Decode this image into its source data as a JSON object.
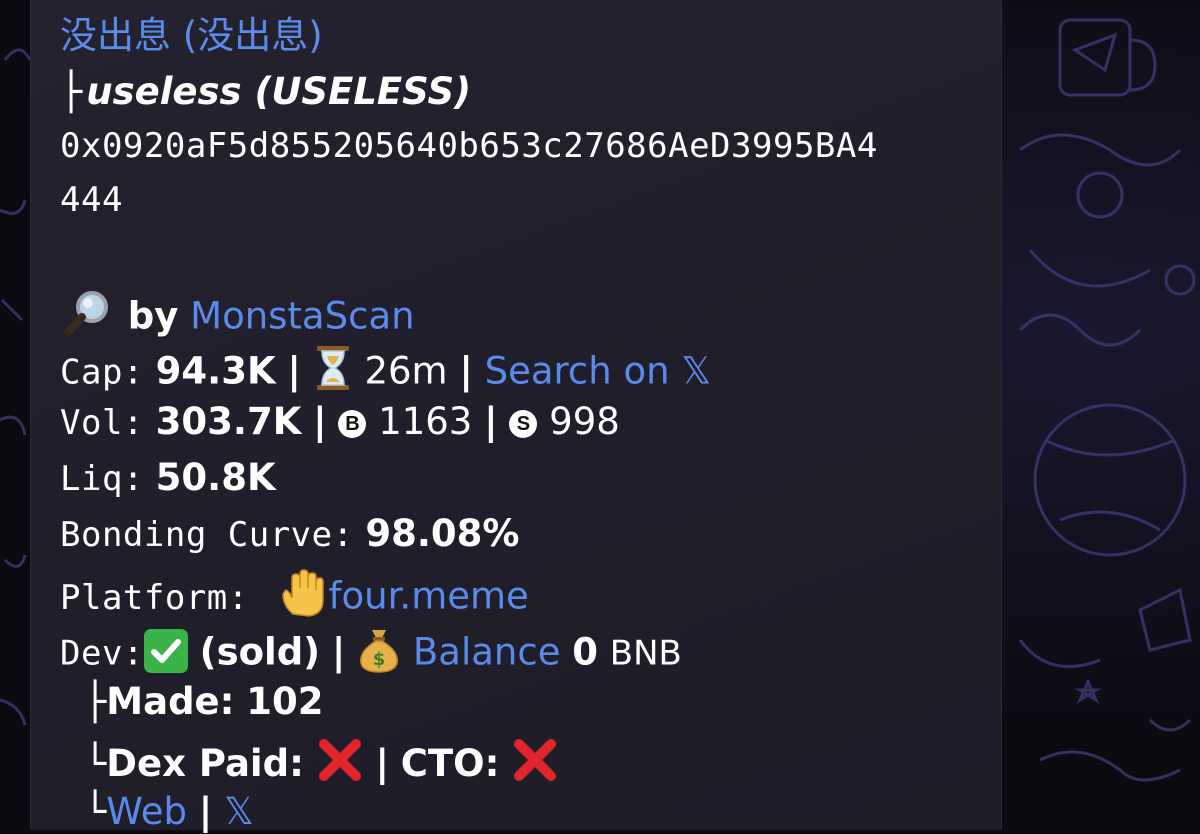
{
  "header": {
    "title_link": "没出息 (没出息)",
    "token_prefix": "├",
    "token_name": "useless (USELESS)",
    "contract_line1": "0x0920aF5d855205640b653c27686AeD3995BA4",
    "contract_line2": "444"
  },
  "scanner": {
    "by_label": "by",
    "by_link": "MonstaScan"
  },
  "stats": {
    "cap_label": "Cap:",
    "cap_value": "94.3K",
    "sep": "|",
    "age": "26m",
    "search_link": "Search on",
    "vol_label": "Vol:",
    "vol_value": "303.7K",
    "buy_icon_letter": "B",
    "buys": "1163",
    "sell_icon_letter": "S",
    "sells": "998",
    "liq_label": "Liq:",
    "liq_value": "50.8K",
    "bonding_label": "Bonding Curve:",
    "bonding_value": "98.08%",
    "platform_label": "Platform:",
    "platform_link": "four.meme"
  },
  "dev": {
    "label": "Dev:",
    "status": "(sold)",
    "balance_link": "Balance",
    "balance_value": "0",
    "balance_unit": "BNB",
    "made_prefix": "├",
    "made_label": "Made:",
    "made_value": "102",
    "dex_prefix": "└",
    "dex_label": "Dex Paid:",
    "cto_label": "CTO:",
    "web_prefix": "└",
    "web_link": "Web"
  },
  "icons": {
    "magnifier": "magnifier-icon",
    "hourglass": "hourglass-icon",
    "x_logo": "x-logo-icon",
    "hand": "raised-hand-icon",
    "check": "check-icon",
    "moneybag": "money-bag-icon",
    "cross": "cross-icon"
  },
  "colors": {
    "link": "#5a8bea",
    "text": "#ffffff",
    "bubble": "#23212d",
    "background": "#0c0b10",
    "check_green": "#3ab34a",
    "cross_red": "#e0242b"
  }
}
